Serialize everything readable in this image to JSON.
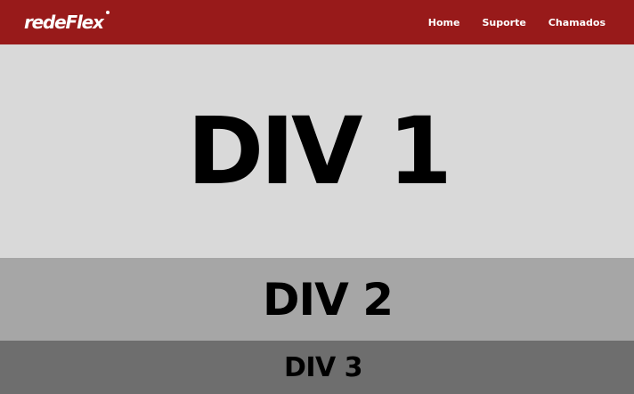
{
  "header": {
    "logo_text": "redeFlex",
    "nav": [
      {
        "label": "Home"
      },
      {
        "label": "Suporte"
      },
      {
        "label": "Chamados"
      }
    ]
  },
  "sections": [
    {
      "label": "DIV 1",
      "color": "#d9d9d9"
    },
    {
      "label": "DIV 2",
      "color": "#a6a6a6"
    },
    {
      "label": "DIV 3",
      "color": "#6e6e6e"
    }
  ],
  "colors": {
    "navbar": "#981a1a",
    "nav_text": "#ffffff",
    "section_text": "#000000"
  }
}
